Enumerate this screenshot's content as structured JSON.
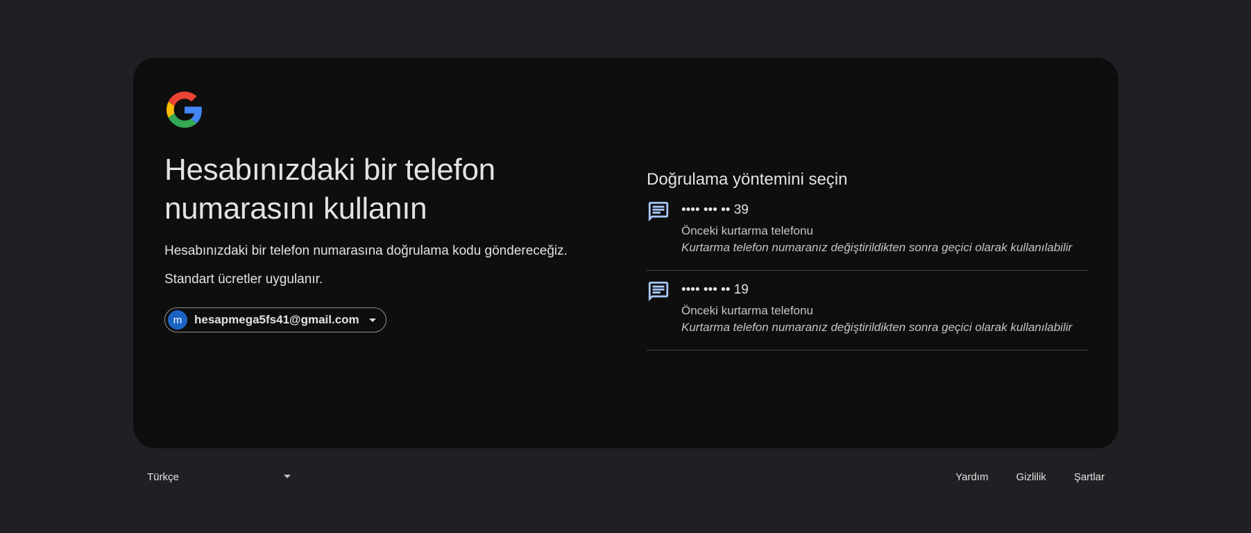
{
  "page": {
    "title": "Hesabınızdaki bir telefon numarasını kullanın",
    "description_1": "Hesabınızdaki bir telefon numarasına doğrulama kodu göndereceğiz.",
    "description_2": "Standart ücretler uygulanır."
  },
  "account": {
    "avatar_letter": "m",
    "email": "hesapmega5fs41@gmail.com"
  },
  "verification": {
    "section_title": "Doğrulama yöntemini seçin",
    "options": [
      {
        "icon": "sms-icon",
        "phone": "•••• ••• •• 39",
        "label": "Önceki kurtarma telefonu",
        "note": "Kurtarma telefon numaranız değiştirildikten sonra geçici olarak kullanılabilir"
      },
      {
        "icon": "sms-icon",
        "phone": "•••• ••• •• 19",
        "label": "Önceki kurtarma telefonu",
        "note": "Kurtarma telefon numaranız değiştirildikten sonra geçici olarak kullanılabilir"
      }
    ]
  },
  "footer": {
    "language": "Türkçe",
    "links": [
      "Yardım",
      "Gizlilik",
      "Şartlar"
    ]
  },
  "colors": {
    "background": "#1f2023",
    "card": "#0e0e0e",
    "text": "#e3e3e3",
    "icon_accent": "#a8c7fa",
    "avatar": "#1a63c4"
  }
}
